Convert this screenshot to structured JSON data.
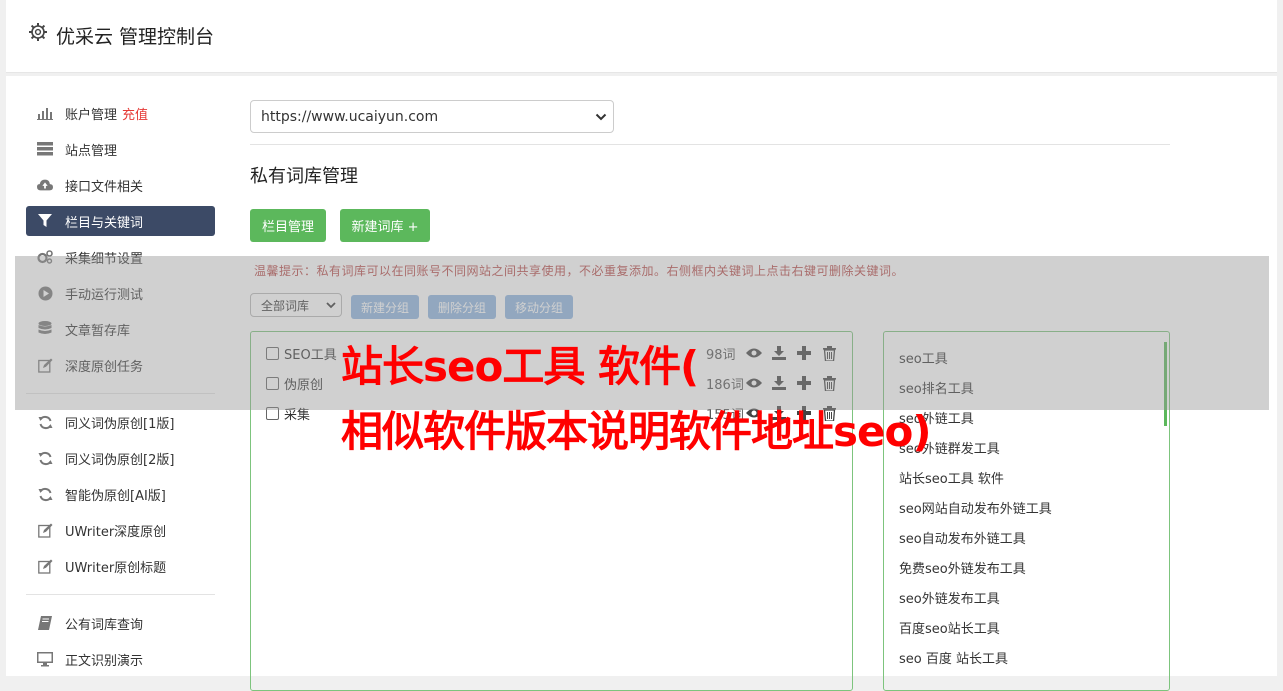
{
  "header": {
    "title": "优采云 管理控制台",
    "icon": "gear-icon"
  },
  "sidebar": {
    "items": [
      {
        "label": "账户管理",
        "badge": "充值",
        "icon": "bar-chart-icon"
      },
      {
        "label": "站点管理",
        "icon": "server-icon"
      },
      {
        "label": "接口文件相关",
        "icon": "cloud-upload-icon"
      },
      {
        "label": "栏目与关键词",
        "icon": "filter-icon",
        "active": true
      },
      {
        "label": "采集细节设置",
        "icon": "cogs-icon"
      },
      {
        "label": "手动运行测试",
        "icon": "play-circle-icon"
      },
      {
        "label": "文章暂存库",
        "icon": "database-icon"
      },
      {
        "label": "深度原创任务",
        "icon": "edit-icon"
      },
      {
        "label": "同义词伪原创[1版]",
        "icon": "refresh-icon"
      },
      {
        "label": "同义词伪原创[2版]",
        "icon": "refresh-icon"
      },
      {
        "label": "智能伪原创[AI版]",
        "icon": "refresh-icon"
      },
      {
        "label": "UWriter深度原创",
        "icon": "edit-icon"
      },
      {
        "label": "UWriter原创标题",
        "icon": "edit-icon"
      },
      {
        "label": "公有词库查询",
        "icon": "book-icon"
      },
      {
        "label": "正文识别演示",
        "icon": "desktop-icon"
      }
    ]
  },
  "main": {
    "site_select_value": "https://www.ucaiyun.com",
    "section_title": "私有词库管理",
    "btn_column_manage": "栏目管理",
    "btn_new_library": "新建词库 +",
    "tip": "温馨提示：私有词库可以在同账号不同网站之间共享使用，不必重复添加。右侧框内关键词上点击右键可删除关键词。",
    "group_select_value": "全部词库",
    "btn_new_group": "新建分组",
    "btn_delete_group": "删除分组",
    "btn_move_group": "移动分组",
    "libraries": [
      {
        "name": "SEO工具",
        "count": "98词"
      },
      {
        "name": "伪原创",
        "count": "186词"
      },
      {
        "name": "采集",
        "count": "155词"
      }
    ],
    "keywords": [
      "seo工具",
      "seo排名工具",
      "seo外链工具",
      "seo外链群发工具",
      "站长seo工具 软件",
      "seo网站自动发布外链工具",
      "seo自动发布外链工具",
      "免费seo外链发布工具",
      "seo外链发布工具",
      "百度seo站长工具",
      "seo 百度 站长工具"
    ]
  },
  "overlay": {
    "line1": "站长seo工具 软件(",
    "line2": "相似软件版本说明软件地址seo)"
  },
  "colors": {
    "accent_green": "#5cb85c",
    "nav_active": "#3c4a66",
    "button_blue": "#8eb5e0",
    "overlay_red": "#ff0000",
    "tip_red": "#b94a48"
  }
}
